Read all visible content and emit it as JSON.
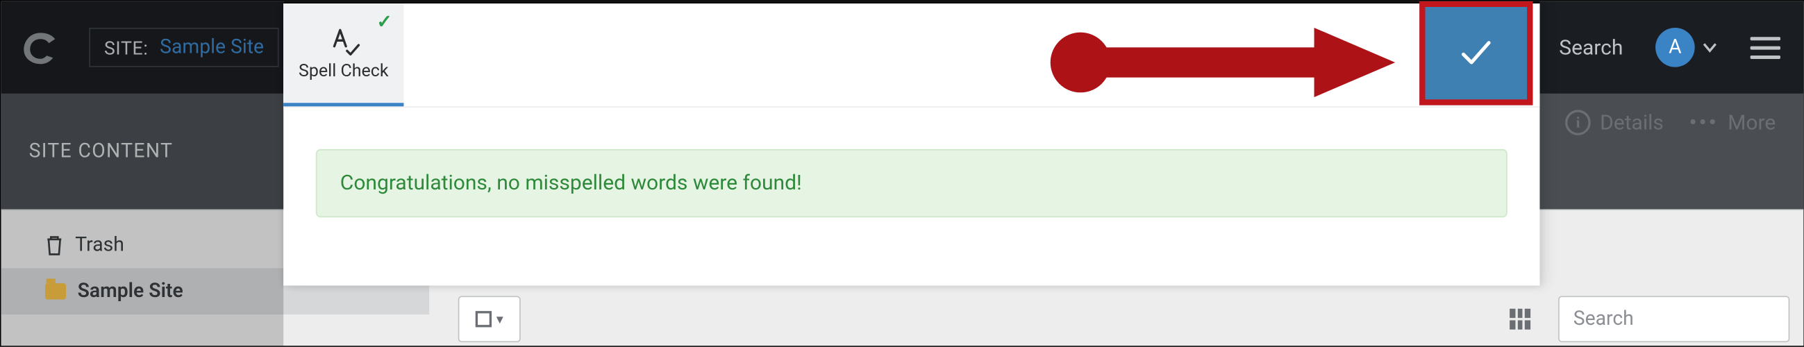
{
  "header": {
    "site_label": "SITE:",
    "site_name": "Sample Site",
    "search_label": "Search",
    "avatar_initial": "A"
  },
  "subheader": {
    "title": "SITE CONTENT",
    "details_label": "Details",
    "more_label": "More"
  },
  "sidebar": {
    "items": [
      {
        "label": "Trash",
        "icon": "trash"
      },
      {
        "label": "Sample Site",
        "icon": "folder",
        "selected": true
      }
    ]
  },
  "list_toolbar": {
    "search_placeholder": "Search"
  },
  "spellcheck_panel": {
    "tab_label": "Spell Check",
    "alert_message": "Congratulations, no misspelled words were found!"
  }
}
